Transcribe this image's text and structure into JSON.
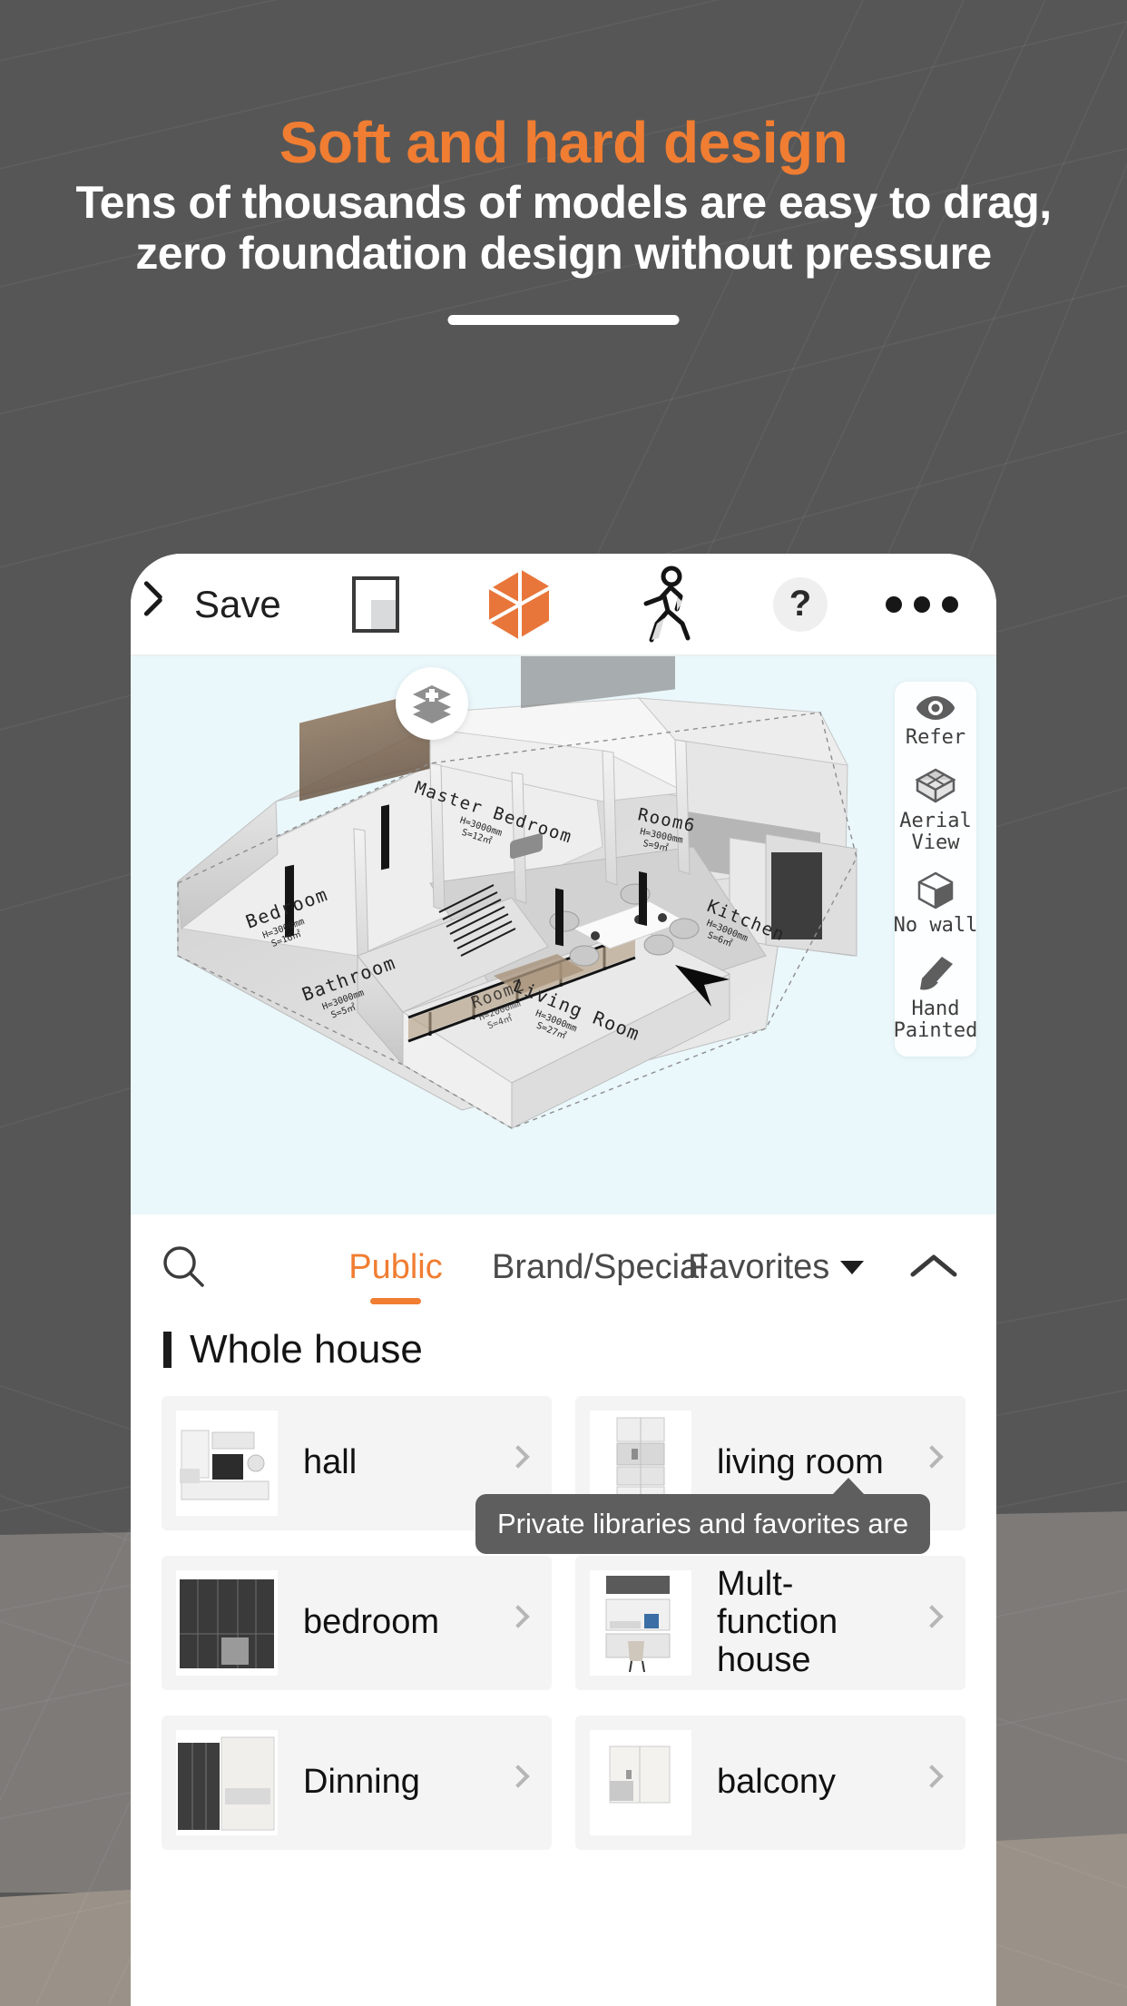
{
  "promo": {
    "headline": "Soft and hard design",
    "subhead_line1": "Tens of thousands of models are easy to drag,",
    "subhead_line2": "zero foundation design without pressure"
  },
  "toolbar": {
    "back_icon": "chevron-left-icon",
    "save_label": "Save",
    "floorplan_icon": "floor-plan-icon",
    "model3d_icon": "3d-cube-icon",
    "walkthrough_icon": "walking-person-icon",
    "help_label": "?",
    "more_icon": "more-horizontal-icon"
  },
  "viewport": {
    "layers_icon": "layers-add-icon",
    "background_color": "#eaf7fb",
    "rail": [
      {
        "icon": "eye-icon",
        "label": "Refer"
      },
      {
        "icon": "aerial-box-icon",
        "label": "Aerial\nView"
      },
      {
        "icon": "cube-icon",
        "label": "No wall"
      },
      {
        "icon": "brush-icon",
        "label": "Hand\nPainted"
      }
    ],
    "rooms": [
      {
        "name": "Bedroom",
        "height": "H=3000mm",
        "area": "S=16㎡"
      },
      {
        "name": "Master Bedroom",
        "height": "H=3000mm",
        "area": "S=12㎡"
      },
      {
        "name": "Bathroom",
        "height": "H=3000mm",
        "area": "S=5㎡"
      },
      {
        "name": "Living Room",
        "height": "H=3000mm",
        "area": "S=27㎡"
      },
      {
        "name": "Room6",
        "height": "H=3000mm",
        "area": "S=9㎡"
      },
      {
        "name": "Kitchen",
        "height": "H=3000mm",
        "area": "S=6㎡"
      },
      {
        "name": "Room2",
        "height": "H=2000mm",
        "area": "S=4㎡"
      }
    ]
  },
  "library": {
    "search_icon": "search-icon",
    "tabs": [
      {
        "label": "Public",
        "active": true
      },
      {
        "label": "Brand/Special",
        "active": false
      },
      {
        "label": "Favorites",
        "active": false,
        "has_dropdown": true
      }
    ],
    "collapse_icon": "chevron-up-icon",
    "tooltip": "Private libraries and favorites are",
    "section_title": "Whole house",
    "items": [
      {
        "label": "hall"
      },
      {
        "label": "living room"
      },
      {
        "label": "bedroom"
      },
      {
        "label": "Mult-function house"
      },
      {
        "label": "Dinning"
      },
      {
        "label": "balcony"
      }
    ]
  },
  "colors": {
    "accent": "#f07d32",
    "background": "#565656",
    "viewport": "#eaf7fb",
    "tooltip": "#5e5e5e"
  }
}
